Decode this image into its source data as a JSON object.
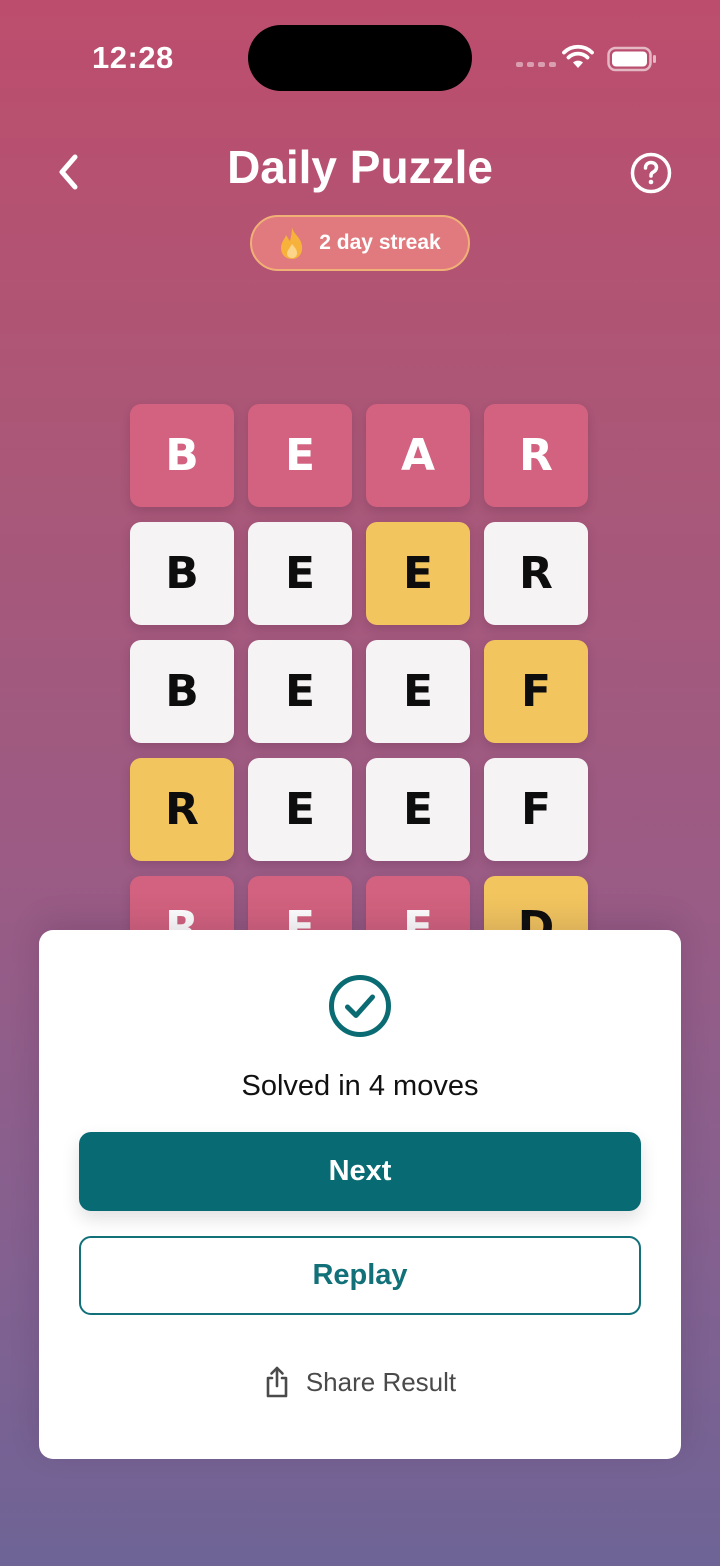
{
  "status_bar": {
    "time": "12:28"
  },
  "header": {
    "title": "Daily Puzzle",
    "back_icon": "chevron-left-icon",
    "help_icon": "question-circle-icon"
  },
  "streak": {
    "label": "2 day streak",
    "icon": "flame-icon"
  },
  "grid": {
    "rows": [
      [
        "B",
        "E",
        "A",
        "R"
      ],
      [
        "B",
        "E",
        "E",
        "R"
      ],
      [
        "B",
        "E",
        "E",
        "F"
      ],
      [
        "R",
        "E",
        "E",
        "F"
      ],
      [
        "R",
        "E",
        "E",
        "D"
      ]
    ]
  },
  "result": {
    "icon": "check-circle-icon",
    "message": "Solved in 4 moves",
    "next_label": "Next",
    "replay_label": "Replay",
    "share_label": "Share Result",
    "share_icon": "share-icon"
  },
  "colors": {
    "primary": "#086b73",
    "tile_pink": "#d2627f",
    "tile_yellow": "#f2c55f",
    "tile_white": "#f6f3f5"
  }
}
